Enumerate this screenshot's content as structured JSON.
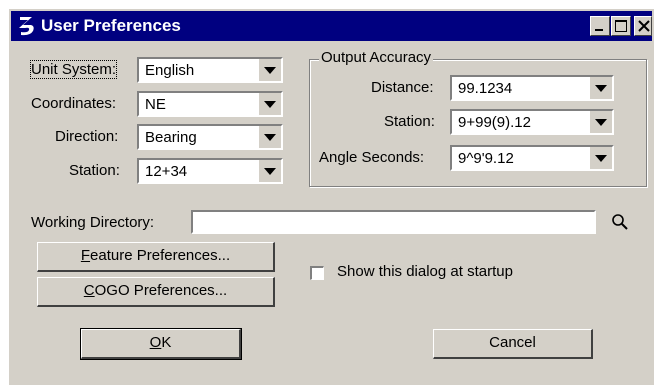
{
  "window": {
    "title": "User Preferences",
    "icon": "bentley-b-icon",
    "controls": [
      "minimize",
      "maximize",
      "close"
    ]
  },
  "settings": {
    "unit_system": {
      "label": "Unit System:",
      "value": "English"
    },
    "coordinates": {
      "label": "Coordinates:",
      "value": "NE"
    },
    "direction": {
      "label": "Direction:",
      "value": "Bearing"
    },
    "station": {
      "label": "Station:",
      "value": "12+34"
    }
  },
  "output_accuracy": {
    "group_label": "Output Accuracy",
    "distance": {
      "label": "Distance:",
      "value": "99.1234"
    },
    "station": {
      "label": "Station:",
      "value": "9+99(9).12"
    },
    "angle_seconds": {
      "label": "Angle Seconds:",
      "value": "9^9'9.12"
    }
  },
  "working_directory": {
    "label": "Working Directory:",
    "value": "",
    "browse_icon": "search-icon"
  },
  "buttons": {
    "feature_prefs": {
      "mnemonic": "F",
      "rest": "eature Preferences..."
    },
    "cogo_prefs": {
      "mnemonic": "C",
      "rest": "OGO Preferences..."
    },
    "ok": {
      "mnemonic": "O",
      "rest": "K"
    },
    "cancel": "Cancel"
  },
  "show_at_startup": {
    "label": "Show this dialog at startup",
    "checked": false
  }
}
